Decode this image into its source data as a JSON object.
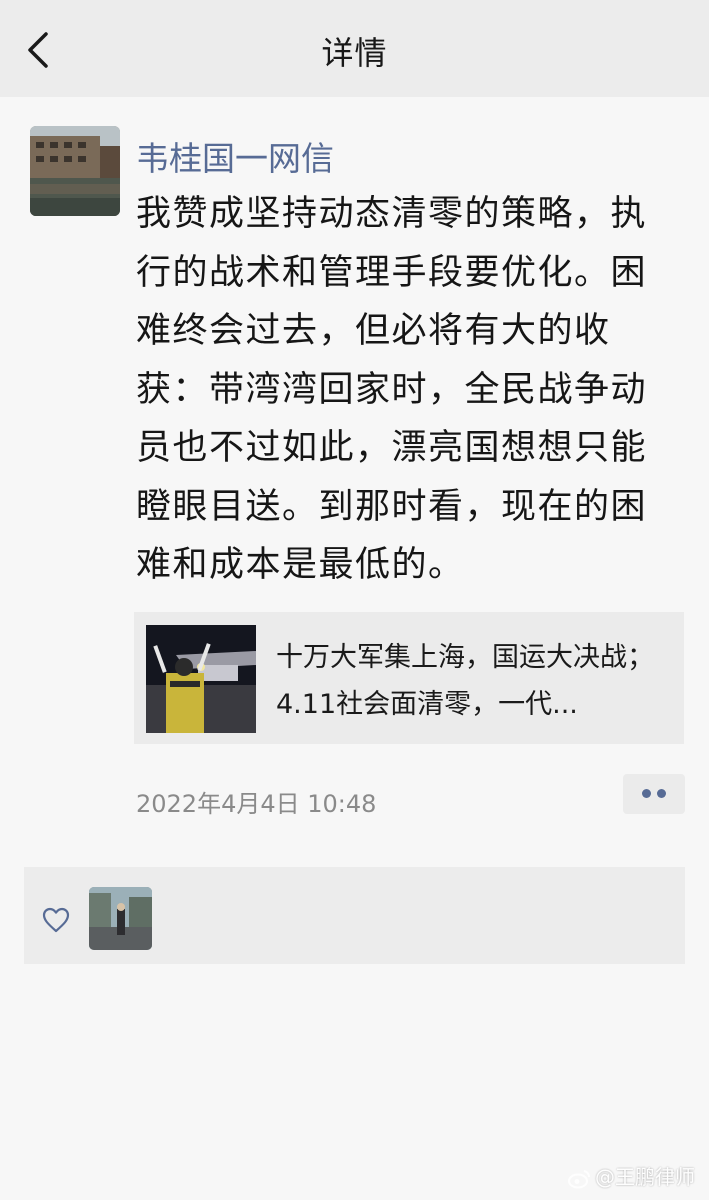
{
  "header": {
    "title": "详情"
  },
  "post": {
    "author": "韦桂国一网信",
    "text": "我赞成坚持动态清零的策略，执行的战术和管理手段要优化。困难终会过去，但必将有大的收获：带湾湾回家时，全民战争动员也不过如此，漂亮国想想只能瞪眼目送。到那时看，现在的困难和成本是最低的。",
    "link_card": {
      "title": "十万大军集上海，国运大决战；4.11社会面清零，一代..."
    },
    "timestamp": "2022年4月4日 10:48"
  },
  "likes": {
    "icon": "heart-icon"
  },
  "watermark": {
    "text": "@王鹏律师"
  },
  "colors": {
    "author_link": "#576b95",
    "background": "#f7f7f7",
    "panel": "#ebebeb"
  }
}
